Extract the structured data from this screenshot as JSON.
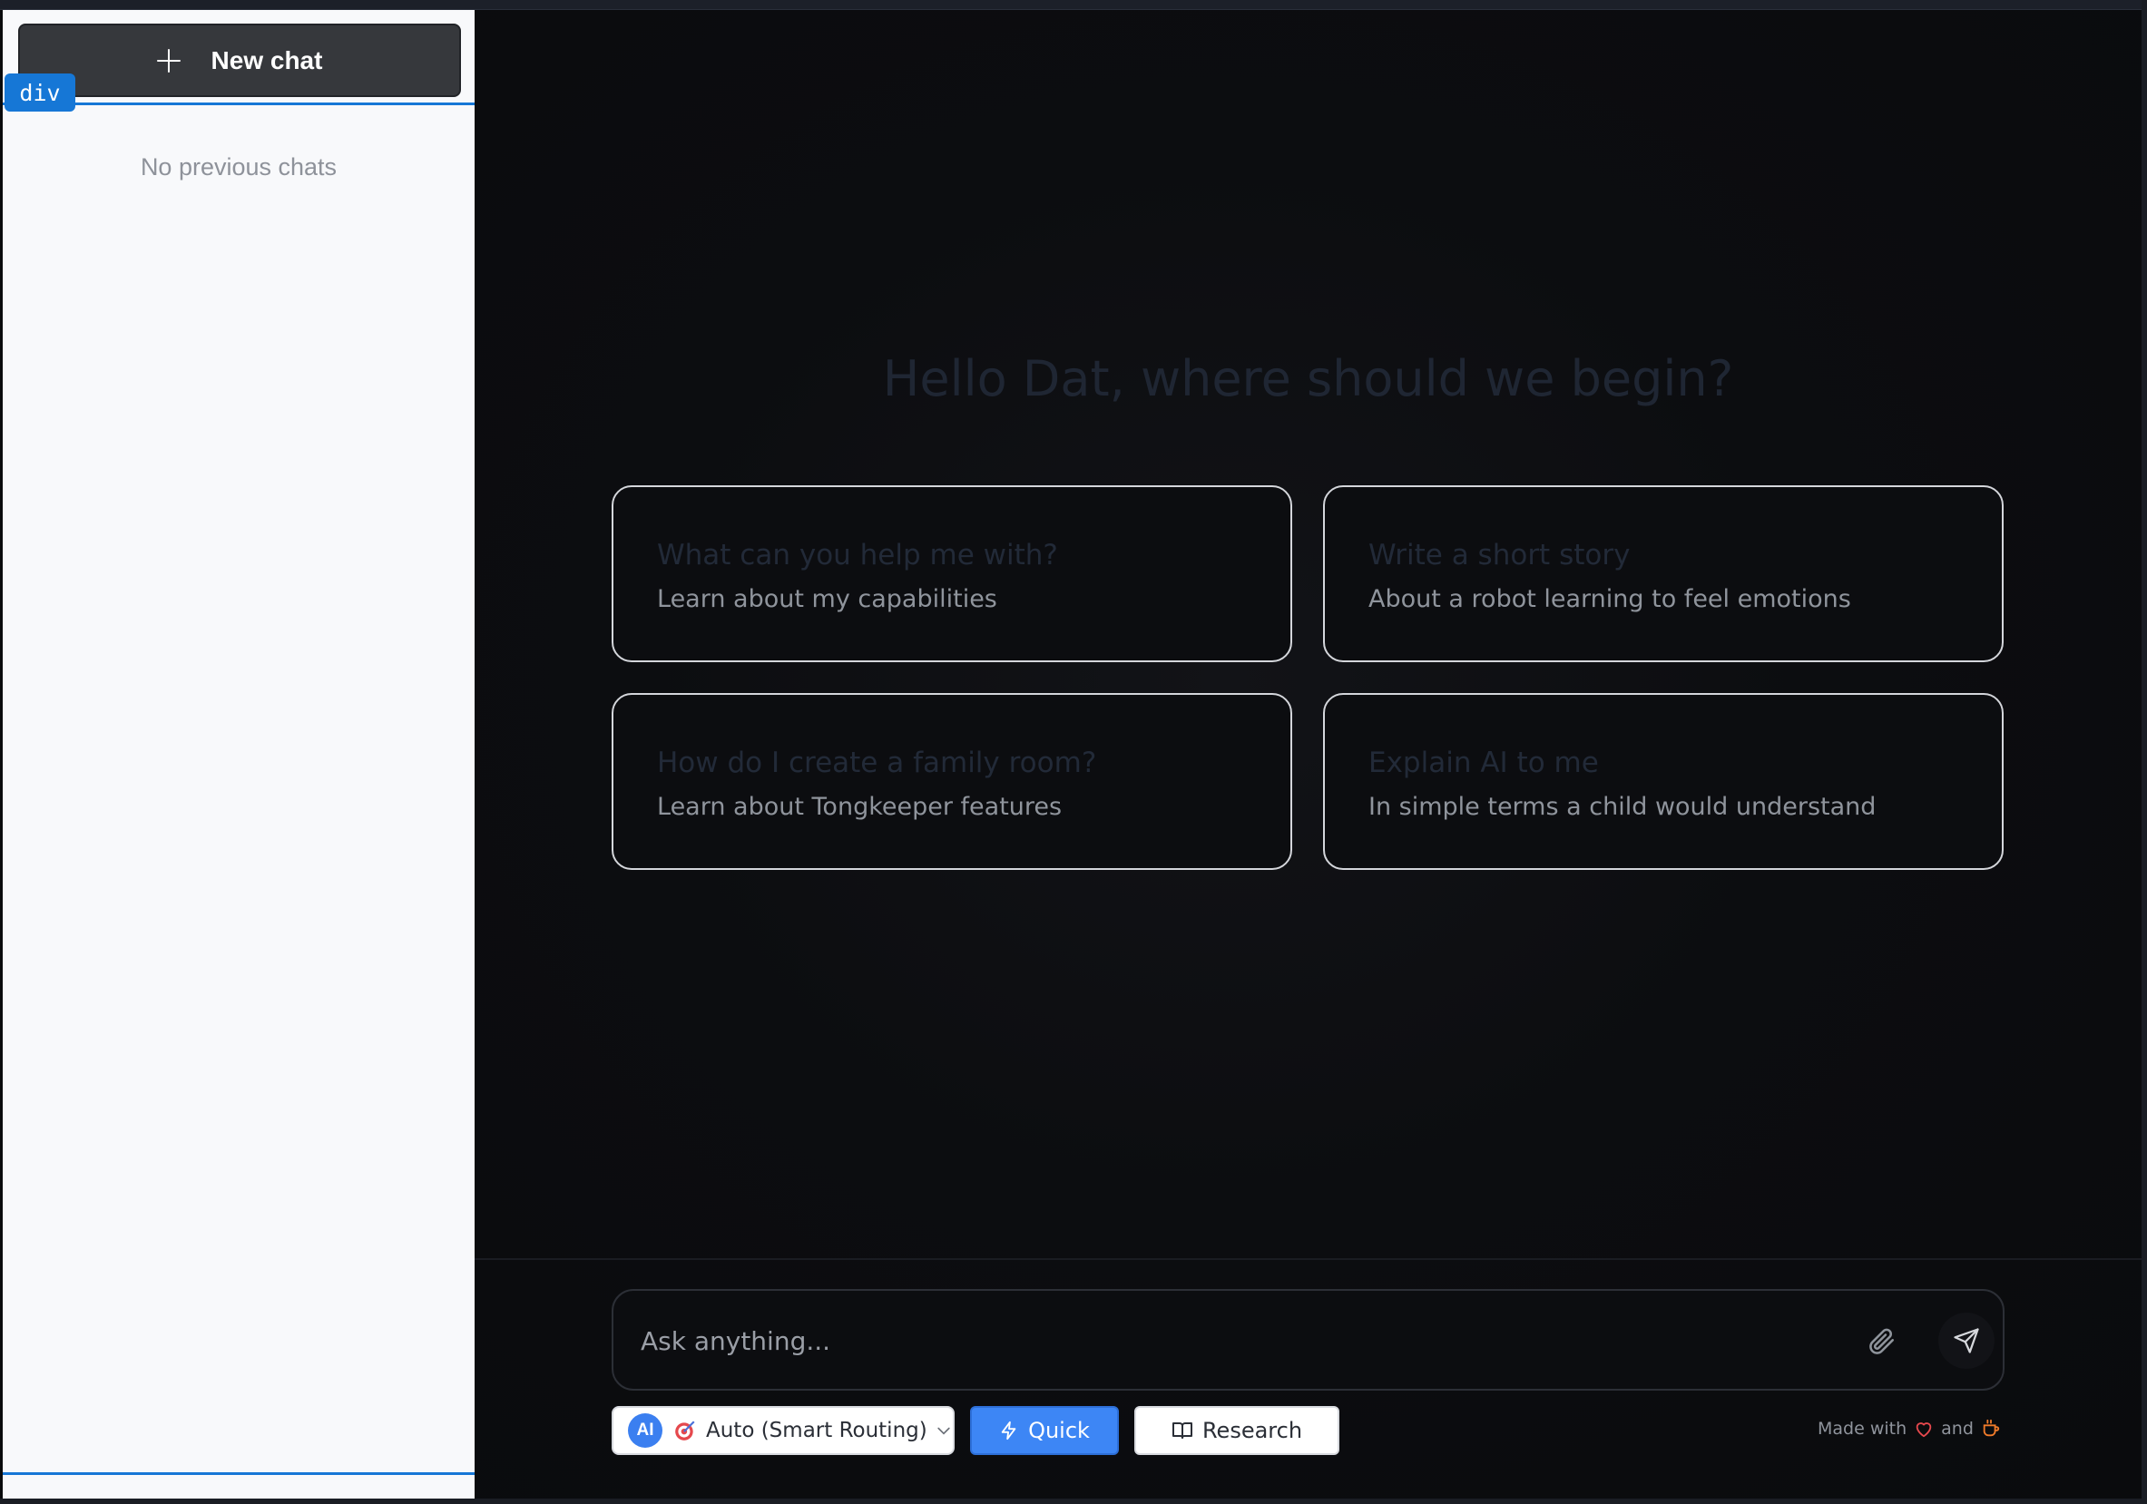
{
  "sidebar": {
    "new_chat_label": "New chat",
    "empty_history": "No previous chats",
    "dev_badge": "div"
  },
  "main": {
    "greeting": "Hello Dat, where should we begin?",
    "suggestions": [
      {
        "title": "What can you help me with?",
        "subtitle": "Learn about my capabilities"
      },
      {
        "title": "Write a short story",
        "subtitle": "About a robot learning to feel emotions"
      },
      {
        "title": "How do I create a family room?",
        "subtitle": "Learn about Tongkeeper features"
      },
      {
        "title": "Explain AI to me",
        "subtitle": "In simple terms a child would understand"
      }
    ]
  },
  "composer": {
    "placeholder": "Ask anything...",
    "model_badge": "AI",
    "model_label": "Auto (Smart Routing)",
    "quick_label": "Quick",
    "research_label": "Research"
  },
  "footer": {
    "made_with": "Made with",
    "and": "and"
  },
  "colors": {
    "accent": "#3d86f5",
    "heart": "#e5484d",
    "coffee": "#f07b2a",
    "selection": "#1677d6"
  },
  "icons": [
    "plus-icon",
    "attach-icon",
    "send-icon",
    "target-icon",
    "chevron-down-icon",
    "bolt-icon",
    "book-icon",
    "heart-icon",
    "coffee-icon"
  ]
}
